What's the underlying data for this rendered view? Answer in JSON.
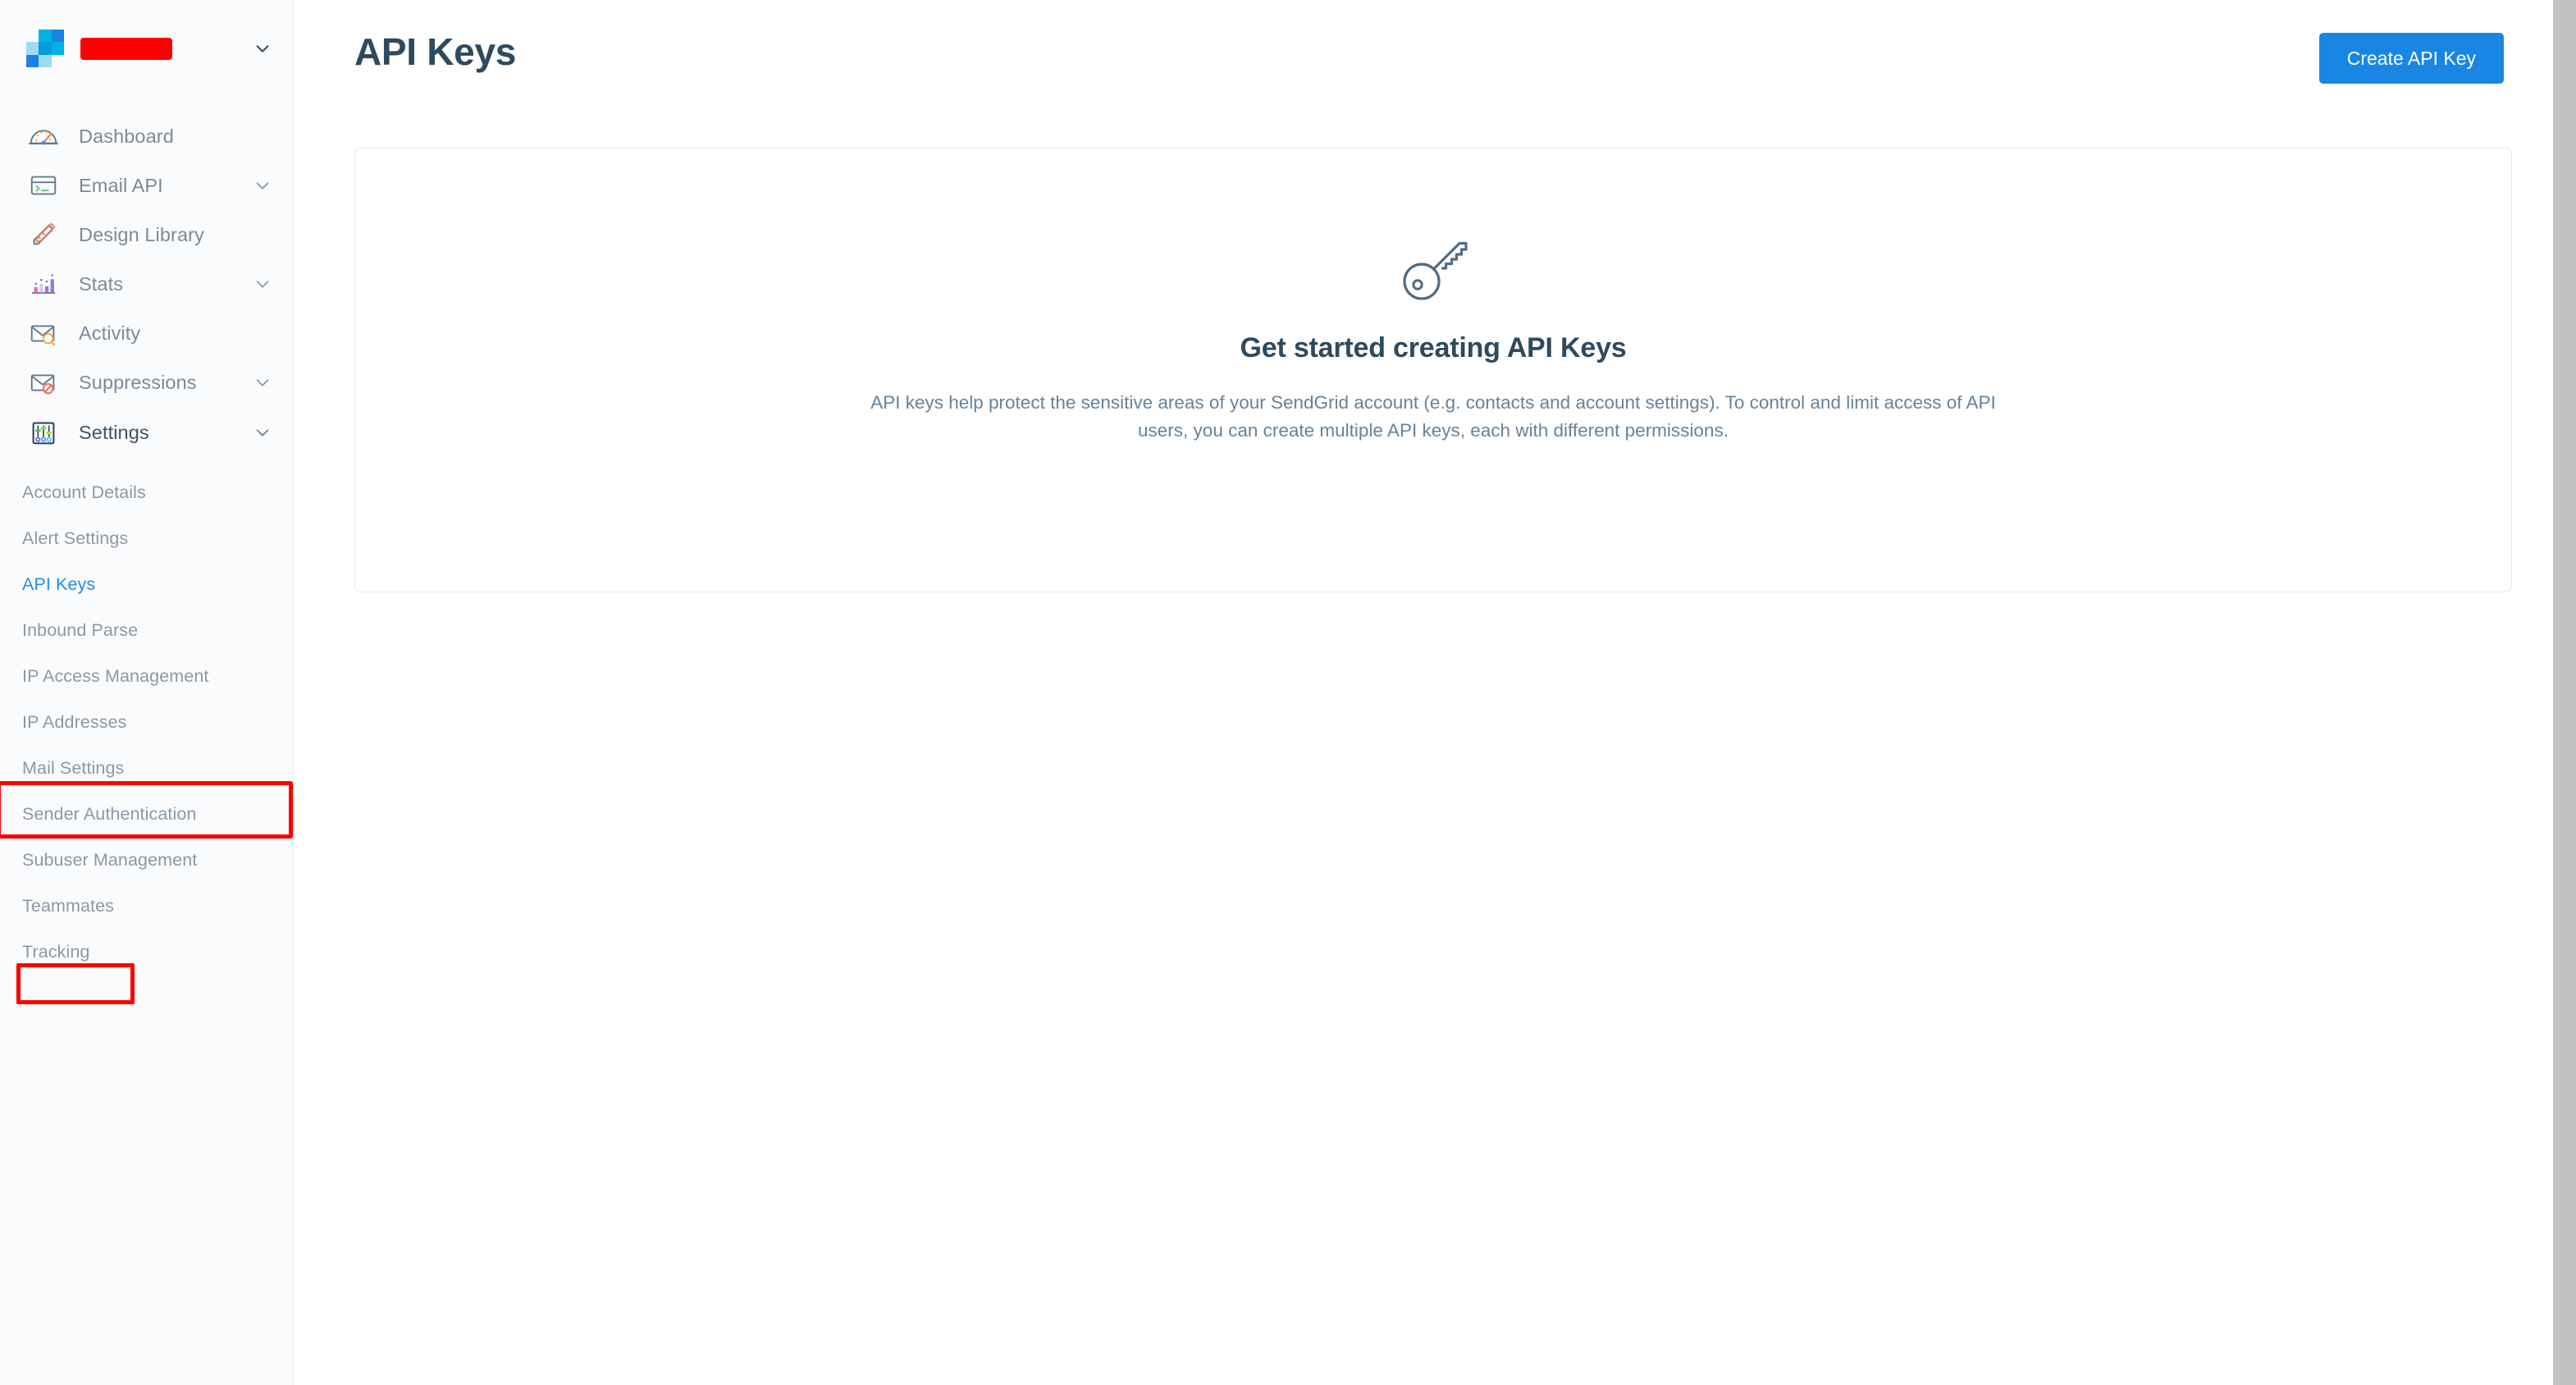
{
  "brand": {
    "logo_icon": "sendgrid-logo-icon",
    "account_name": "",
    "account_name_redacted": true,
    "caret_icon": "chevron-down-icon"
  },
  "colors": {
    "accent_blue": "#1a86e4",
    "active_link_blue": "#1f8ceb",
    "title_navy": "#2e4a5e",
    "nav_text": "#7a8b99",
    "subnav_text": "#8a99a6",
    "body_text": "#66839b",
    "sidebar_bg": "#fafbfc",
    "card_border": "#e4e8ed",
    "annotation_red": "#fe0000",
    "logo_cyan": "#00b2e3",
    "logo_blue": "#1a82e2",
    "logo_light": "#9bdbf5",
    "logo_dark_cyan": "#009dd9"
  },
  "sidebar": {
    "nav_items": [
      {
        "label": "Dashboard",
        "icon": "speedometer-icon",
        "has_caret": false,
        "active": false
      },
      {
        "label": "Email API",
        "icon": "terminal-window-icon",
        "has_caret": true,
        "active": false
      },
      {
        "label": "Design Library",
        "icon": "ruler-pencil-icon",
        "has_caret": false,
        "active": false
      },
      {
        "label": "Stats",
        "icon": "bar-chart-icon",
        "has_caret": true,
        "active": false
      },
      {
        "label": "Activity",
        "icon": "envelope-search-icon",
        "has_caret": false,
        "active": false
      },
      {
        "label": "Suppressions",
        "icon": "envelope-blocked-icon",
        "has_caret": true,
        "active": false
      },
      {
        "label": "Settings",
        "icon": "sliders-icon",
        "has_caret": true,
        "active": true
      }
    ],
    "subnav_items": [
      {
        "label": "Account Details",
        "active": false
      },
      {
        "label": "Alert Settings",
        "active": false
      },
      {
        "label": "API Keys",
        "active": true
      },
      {
        "label": "Inbound Parse",
        "active": false
      },
      {
        "label": "IP Access Management",
        "active": false
      },
      {
        "label": "IP Addresses",
        "active": false
      },
      {
        "label": "Mail Settings",
        "active": false
      },
      {
        "label": "Sender Authentication",
        "active": false
      },
      {
        "label": "Subuser Management",
        "active": false
      },
      {
        "label": "Teammates",
        "active": false
      },
      {
        "label": "Tracking",
        "active": false
      }
    ]
  },
  "header": {
    "title": "API Keys",
    "create_button_label": "Create API Key"
  },
  "empty_state": {
    "icon": "key-icon",
    "heading": "Get started creating API Keys",
    "body": "API keys help protect the sensitive areas of your SendGrid account (e.g. contacts and account settings). To control and limit access of API users, you can create multiple API keys, each with different permissions."
  },
  "annotations": [
    {
      "name": "settings-nav-highlight",
      "target": "Settings"
    },
    {
      "name": "api-keys-subnav-highlight",
      "target": "API Keys"
    }
  ]
}
